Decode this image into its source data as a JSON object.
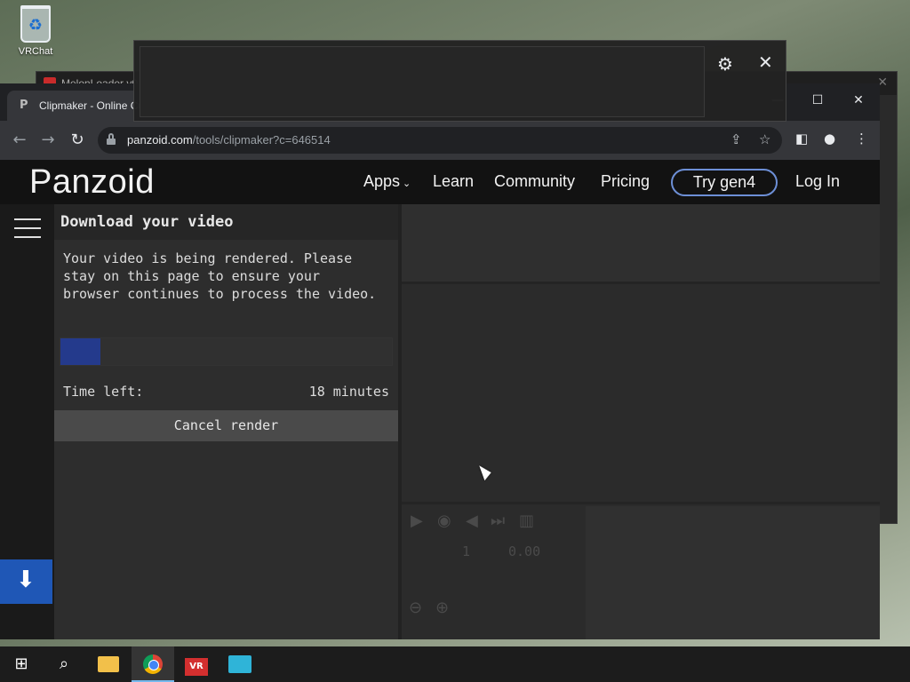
{
  "desktop": {
    "icon_label": "VRChat"
  },
  "background_window": {
    "title": "MelonLoader v0"
  },
  "browser": {
    "tab_title": "Clipmaker - Online Custom Int",
    "tab_favicon": "P",
    "url_host": "panzoid.com",
    "url_path": "/tools/clipmaker?c=646514"
  },
  "site": {
    "logo": "Panzoid",
    "nav": {
      "apps": "Apps",
      "learn": "Learn",
      "community": "Community",
      "pricing": "Pricing",
      "try": "Try gen4",
      "login": "Log In"
    }
  },
  "download_panel": {
    "title": "Download your video",
    "message": "Your video is being rendered. Please stay on this page to ensure your browser continues to process the video.",
    "progress_fraction": 0.12,
    "time_left_label": "Time left:",
    "time_left_value": "18 minutes",
    "cancel_label": "Cancel render"
  },
  "player": {
    "frame": "1",
    "time": "0.00"
  },
  "colors": {
    "accent": "#243a8c",
    "download_tile": "#1f57b6",
    "try_border": "#6d8fd6"
  }
}
